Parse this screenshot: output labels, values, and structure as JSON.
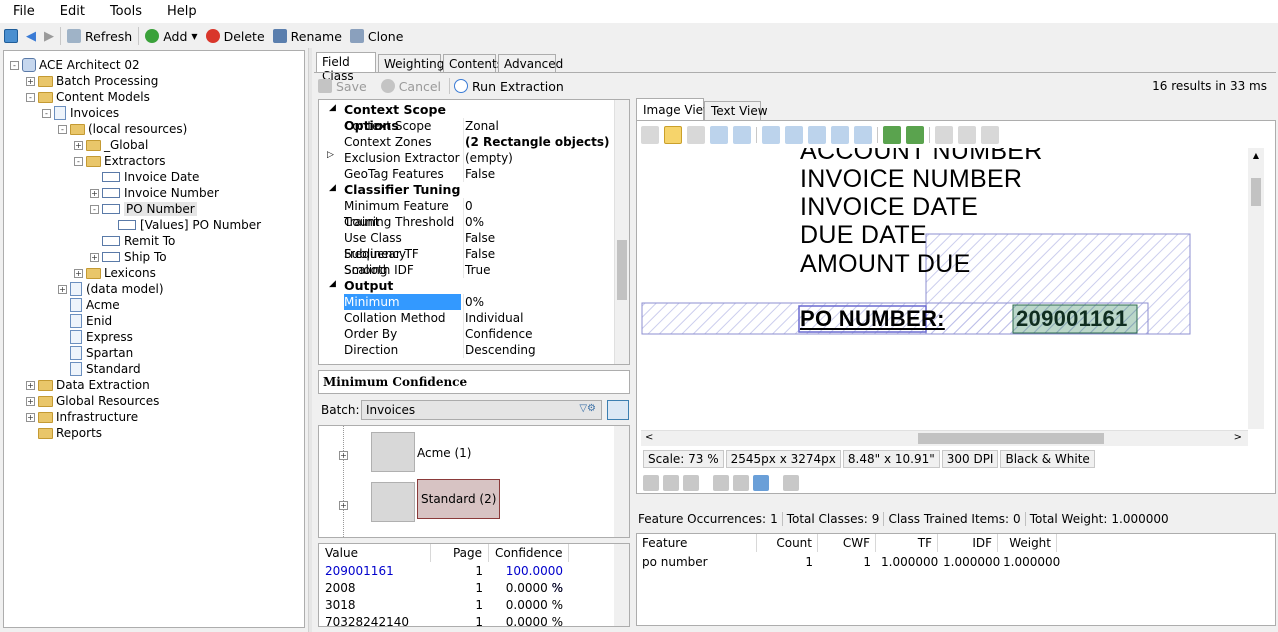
{
  "menu": [
    "File",
    "Edit",
    "Tools",
    "Help"
  ],
  "toolbar": {
    "refresh": "Refresh",
    "add": "Add",
    "delete": "Delete",
    "rename": "Rename",
    "clone": "Clone"
  },
  "tree": [
    {
      "label": "ACE Architect 02",
      "icon": "database-icon",
      "depth": 0,
      "exp": "-"
    },
    {
      "label": "Batch Processing",
      "icon": "folder-icon",
      "depth": 1,
      "exp": "+"
    },
    {
      "label": "Content Models",
      "icon": "folder-icon",
      "depth": 1,
      "exp": "-"
    },
    {
      "label": "Invoices",
      "icon": "document-icon",
      "depth": 2,
      "exp": "-"
    },
    {
      "label": "(local resources)",
      "icon": "folder-icon",
      "depth": 3,
      "exp": "-"
    },
    {
      "label": "_Global",
      "icon": "folder-icon",
      "depth": 4,
      "exp": "+"
    },
    {
      "label": "Extractors",
      "icon": "folder-icon",
      "depth": 4,
      "exp": "-"
    },
    {
      "label": "Invoice Date",
      "icon": "field-icon",
      "depth": 5,
      "exp": ""
    },
    {
      "label": "Invoice Number",
      "icon": "field-icon",
      "depth": 5,
      "exp": "+"
    },
    {
      "label": "PO Number",
      "icon": "field-icon",
      "depth": 5,
      "exp": "-"
    },
    {
      "label": "[Values] PO Number",
      "icon": "values-icon",
      "depth": 6,
      "exp": ""
    },
    {
      "label": "Remit To",
      "icon": "field-icon",
      "depth": 5,
      "exp": ""
    },
    {
      "label": "Ship To",
      "icon": "field-icon",
      "depth": 5,
      "exp": "+"
    },
    {
      "label": "Lexicons",
      "icon": "folder-icon",
      "depth": 4,
      "exp": "+"
    },
    {
      "label": "(data model)",
      "icon": "list-icon",
      "depth": 3,
      "exp": "+"
    },
    {
      "label": "Acme",
      "icon": "document-icon",
      "depth": 3,
      "exp": ""
    },
    {
      "label": "Enid",
      "icon": "document-icon",
      "depth": 3,
      "exp": ""
    },
    {
      "label": "Express",
      "icon": "document-icon",
      "depth": 3,
      "exp": ""
    },
    {
      "label": "Spartan",
      "icon": "document-icon",
      "depth": 3,
      "exp": ""
    },
    {
      "label": "Standard",
      "icon": "document-icon",
      "depth": 3,
      "exp": ""
    },
    {
      "label": "Data Extraction",
      "icon": "folder-icon",
      "depth": 1,
      "exp": "+"
    },
    {
      "label": "Global Resources",
      "icon": "folder-icon",
      "depth": 1,
      "exp": "+"
    },
    {
      "label": "Infrastructure",
      "icon": "folder-icon",
      "depth": 1,
      "exp": "+"
    },
    {
      "label": "Reports",
      "icon": "folder-icon",
      "depth": 1,
      "exp": ""
    }
  ],
  "tabs": [
    "Field Class",
    "Weightings",
    "Contents",
    "Advanced"
  ],
  "actions": {
    "save": "Save",
    "cancel": "Cancel",
    "run": "Run Extraction",
    "results": "16 results in 33 ms"
  },
  "props": [
    {
      "type": "cat",
      "k": "Context Scope Options"
    },
    {
      "k": "Context Scope",
      "v": "Zonal"
    },
    {
      "k": "Context Zones",
      "v": "(2 Rectangle objects)",
      "bold": true
    },
    {
      "k": "Exclusion Extractor",
      "v": "(empty)",
      "arrow": true
    },
    {
      "k": "GeoTag Features",
      "v": "False"
    },
    {
      "type": "cat",
      "k": "Classifier Tuning"
    },
    {
      "k": "Minimum Feature Count",
      "v": "0"
    },
    {
      "k": "Training Threshold",
      "v": "0%"
    },
    {
      "k": "Use Class Frequency",
      "v": "False"
    },
    {
      "k": "Sublinear TF Scaling",
      "v": "False"
    },
    {
      "k": "Smooth IDF",
      "v": "True"
    },
    {
      "type": "cat",
      "k": "Output"
    },
    {
      "k": "Minimum Confidence",
      "v": "0%",
      "selected": true
    },
    {
      "k": "Collation Method",
      "v": "Individual"
    },
    {
      "k": "Order By",
      "v": "Confidence"
    },
    {
      "k": "Direction",
      "v": "Descending"
    }
  ],
  "description_title": "Minimum Confidence",
  "batch": {
    "label": "Batch:",
    "value": "Invoices"
  },
  "thumbs": [
    {
      "label": "Acme (1)"
    },
    {
      "label": "Standard (2)",
      "selected": true
    }
  ],
  "values_table": {
    "headers": [
      "Value",
      "Page",
      "Confidence"
    ],
    "rows": [
      {
        "value": "209001161",
        "page": "1",
        "conf": "100.0000 %",
        "highlight": true
      },
      {
        "value": "2008",
        "page": "1",
        "conf": "0.0000 %"
      },
      {
        "value": "3018",
        "page": "1",
        "conf": "0.0000 %"
      },
      {
        "value": "70328242140",
        "page": "1",
        "conf": "0.0000 %"
      }
    ]
  },
  "image_tabs": [
    "Image View",
    "Text View"
  ],
  "document_lines": [
    "ACCOUNT NUMBER",
    "INVOICE NUMBER",
    "INVOICE DATE",
    "DUE DATE",
    "AMOUNT DUE"
  ],
  "po_label": "PO NUMBER:",
  "po_value": "209001161",
  "status": [
    "Scale: 73 %",
    "2545px x 3274px",
    "8.48\" x 10.91\"",
    "300 DPI",
    "Black & White"
  ],
  "feature_info": {
    "occ_label": "Feature Occurrences:",
    "occ": "1",
    "classes_label": "Total Classes:",
    "classes": "9",
    "trained_label": "Class Trained Items:",
    "trained": "0",
    "weight_label": "Total Weight:",
    "weight": "1.000000"
  },
  "feature_table": {
    "headers": [
      "Feature",
      "Count",
      "CWF",
      "TF",
      "IDF",
      "Weight"
    ],
    "row": [
      "po number",
      "1",
      "1",
      "1.000000",
      "1.000000",
      "1.000000"
    ]
  },
  "colors": {
    "accent": "#3399ff",
    "link": "#0000cc",
    "selection": "#3399ff",
    "zone": "#9999dd",
    "match": "#3c8c64"
  }
}
